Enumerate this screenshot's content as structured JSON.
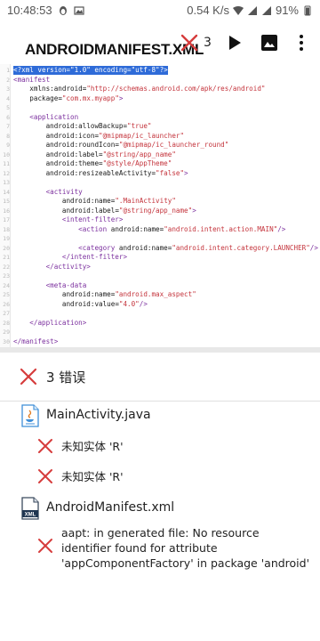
{
  "status_bar": {
    "time": "10:48:53",
    "net_speed": "0.54 K/s",
    "battery": "91%"
  },
  "toolbar": {
    "title": "ANDROIDMANIFEST.XML",
    "error_count": "3"
  },
  "editor": {
    "lines": [
      {
        "n": "1",
        "text": "<?xml version=\"1.0\" encoding=\"utf-8\"?>"
      },
      {
        "n": "2",
        "text": "<manifest"
      },
      {
        "n": "3",
        "text": "    xmlns:android=\"http://schemas.android.com/apk/res/android\""
      },
      {
        "n": "4",
        "text": "    package=\"com.mx.myapp\">"
      },
      {
        "n": "5",
        "text": ""
      },
      {
        "n": "6",
        "text": "    <application"
      },
      {
        "n": "7",
        "text": "        android:allowBackup=\"true\""
      },
      {
        "n": "8",
        "text": "        android:icon=\"@mipmap/ic_launcher\""
      },
      {
        "n": "9",
        "text": "        android:roundIcon=\"@mipmap/ic_launcher_round\""
      },
      {
        "n": "10",
        "text": "        android:label=\"@string/app_name\""
      },
      {
        "n": "11",
        "text": "        android:theme=\"@style/AppTheme\""
      },
      {
        "n": "12",
        "text": "        android:resizeableActivity=\"false\">"
      },
      {
        "n": "13",
        "text": ""
      },
      {
        "n": "14",
        "text": "        <activity"
      },
      {
        "n": "15",
        "text": "            android:name=\".MainActivity\""
      },
      {
        "n": "16",
        "text": "            android:label=\"@string/app_name\">"
      },
      {
        "n": "17",
        "text": "            <intent-filter>"
      },
      {
        "n": "18",
        "text": "                <action android:name=\"android.intent.action.MAIN\"/>"
      },
      {
        "n": "19",
        "text": ""
      },
      {
        "n": "20",
        "text": "                <category android:name=\"android.intent.category.LAUNCHER\"/>"
      },
      {
        "n": "21",
        "text": "            </intent-filter>"
      },
      {
        "n": "22",
        "text": "        </activity>"
      },
      {
        "n": "23",
        "text": ""
      },
      {
        "n": "24",
        "text": "        <meta-data"
      },
      {
        "n": "25",
        "text": "            android:name=\"android.max_aspect\""
      },
      {
        "n": "26",
        "text": "            android:value=\"4.0\"/>"
      },
      {
        "n": "27",
        "text": ""
      },
      {
        "n": "28",
        "text": "    </application>"
      },
      {
        "n": "29",
        "text": ""
      },
      {
        "n": "30",
        "text": "</manifest>"
      }
    ]
  },
  "errors_panel": {
    "header": "3 错误",
    "files": [
      {
        "name": "MainActivity.java",
        "icon": "java-file-icon",
        "errors": [
          "未知实体 'R'",
          "未知实体 'R'"
        ]
      },
      {
        "name": "AndroidManifest.xml",
        "icon": "xml-file-icon",
        "icon_label": "XML",
        "errors": [
          "aapt: in generated file: No resource identifier found for attribute 'appComponentFactory' in package 'android'"
        ]
      }
    ]
  },
  "colors": {
    "error_red": "#d63c3c",
    "selection_blue": "#2e6bd8",
    "tag_purple": "#7b2f9e",
    "value_red": "#c4343c"
  }
}
